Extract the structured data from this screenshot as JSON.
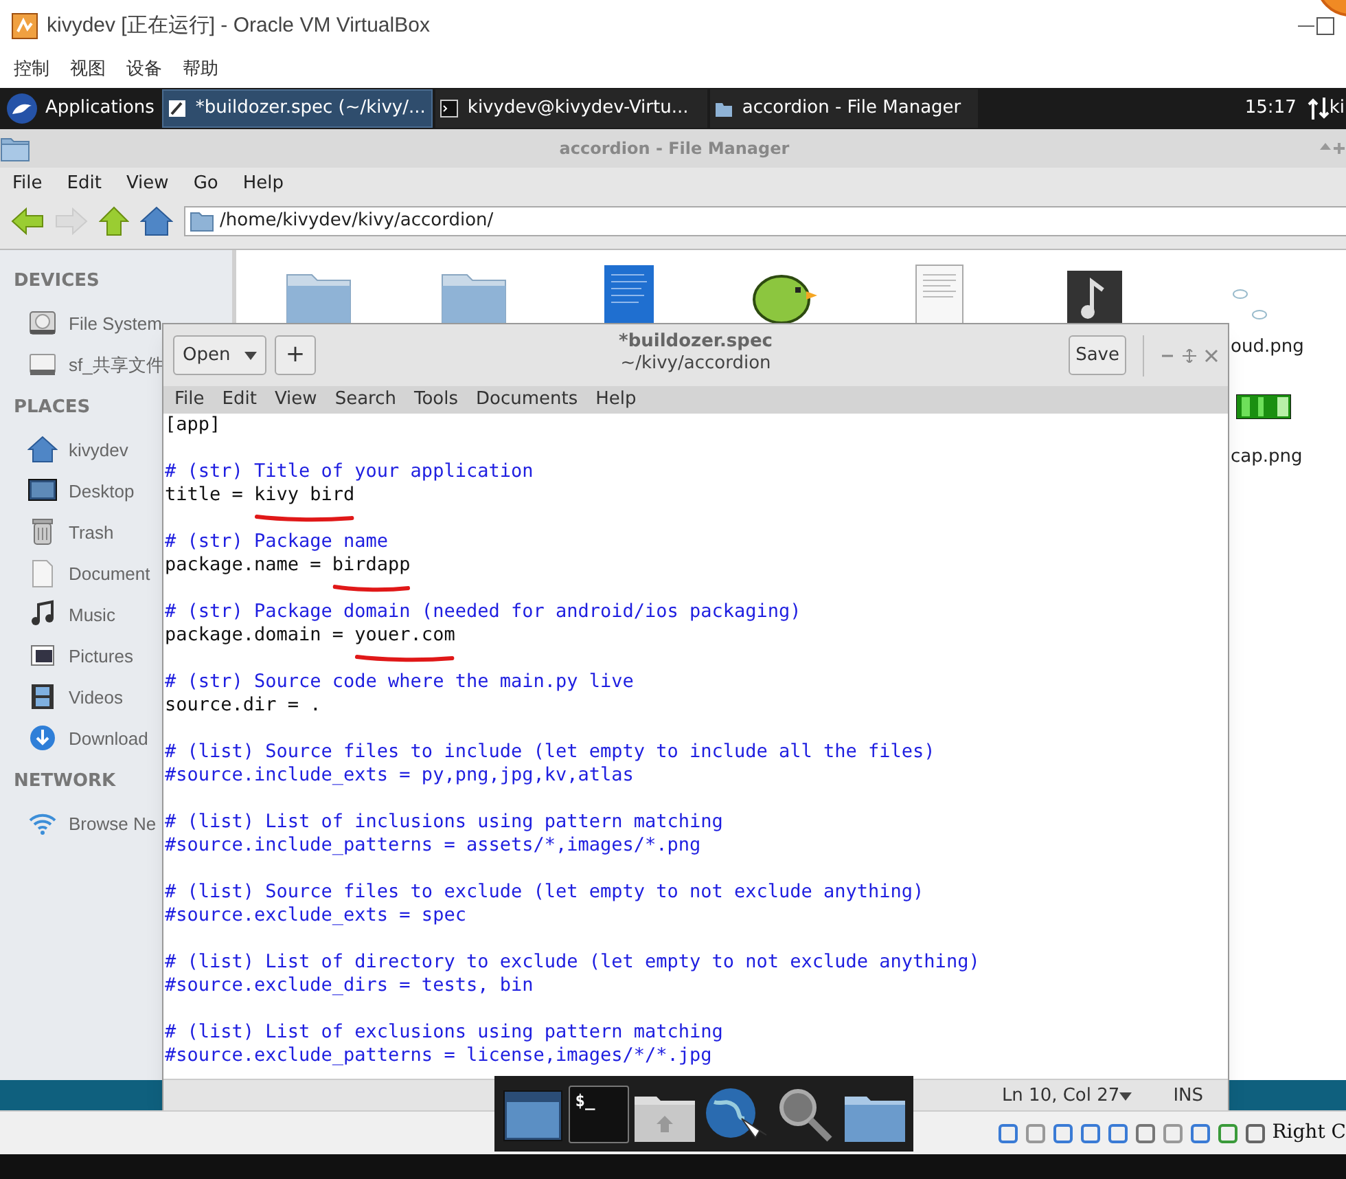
{
  "host_window": {
    "title": "kivydev [正在运行] - Oracle VM VirtualBox",
    "menu": [
      "控制",
      "视图",
      "设备",
      "帮助"
    ]
  },
  "taskbar": {
    "apps_label": "Applications",
    "tasks": [
      {
        "label": "*buildozer.spec (~/kivy/...",
        "kind": "editor",
        "selected": true
      },
      {
        "label": "kivydev@kivydev-Virtu...",
        "kind": "terminal",
        "selected": false
      },
      {
        "label": "accordion - File Manager",
        "kind": "folder",
        "selected": false
      }
    ],
    "clock": "15:17",
    "user": "ki"
  },
  "file_manager": {
    "title": "accordion - File Manager",
    "menu": [
      "File",
      "Edit",
      "View",
      "Go",
      "Help"
    ],
    "path": "/home/kivydev/kivy/accordion/",
    "sidebar": [
      {
        "heading": "DEVICES",
        "items": [
          {
            "label": "File System",
            "kind": "disk"
          },
          {
            "label": "sf_共享文件",
            "kind": "drive"
          }
        ]
      },
      {
        "heading": "PLACES",
        "items": [
          {
            "label": "kivydev",
            "kind": "home"
          },
          {
            "label": "Desktop",
            "kind": "desktop"
          },
          {
            "label": "Trash",
            "kind": "trash"
          },
          {
            "label": "Document",
            "kind": "document"
          },
          {
            "label": "Music",
            "kind": "music"
          },
          {
            "label": "Pictures",
            "kind": "pictures"
          },
          {
            "label": "Videos",
            "kind": "videos"
          },
          {
            "label": "Download",
            "kind": "download"
          }
        ]
      },
      {
        "heading": "NETWORK",
        "items": [
          {
            "label": "Browse Ne",
            "kind": "wifi"
          }
        ]
      }
    ],
    "files": [
      {
        "kind": "folder"
      },
      {
        "kind": "folder"
      },
      {
        "kind": "blue-doc"
      },
      {
        "kind": "bird"
      },
      {
        "kind": "text-doc"
      },
      {
        "kind": "music"
      },
      {
        "kind": "cloud"
      }
    ],
    "side_files": [
      {
        "kind": "cloud-label",
        "label": "oud.png"
      },
      {
        "kind": "bar",
        "label": "cap.png"
      }
    ]
  },
  "editor": {
    "title": "*buildozer.spec",
    "subtitle": "~/kivy/accordion",
    "open_label": "Open",
    "new_label": "+",
    "save_label": "Save",
    "menu": [
      "File",
      "Edit",
      "View",
      "Search",
      "Tools",
      "Documents",
      "Help"
    ],
    "lines": [
      {
        "kind": "code",
        "text": "[app]"
      },
      {
        "kind": "blank"
      },
      {
        "kind": "comment",
        "text": "# (str) Title of your application"
      },
      {
        "kind": "code",
        "text": "title = ",
        "marked": "kivy bird"
      },
      {
        "kind": "blank"
      },
      {
        "kind": "comment",
        "text": "# (str) Package name"
      },
      {
        "kind": "code",
        "text": "package.name = ",
        "marked": "birdapp"
      },
      {
        "kind": "blank"
      },
      {
        "kind": "comment",
        "text": "# (str) Package domain (needed for android/ios packaging)"
      },
      {
        "kind": "code",
        "text": "package.domain = ",
        "marked": "youer.com"
      },
      {
        "kind": "blank"
      },
      {
        "kind": "comment",
        "text": "# (str) Source code where the main.py live"
      },
      {
        "kind": "code",
        "text": "source.dir = ."
      },
      {
        "kind": "blank"
      },
      {
        "kind": "comment",
        "text": "# (list) Source files to include (let empty to include all the files)"
      },
      {
        "kind": "comment",
        "text": "#source.include_exts = py,png,jpg,kv,atlas"
      },
      {
        "kind": "blank"
      },
      {
        "kind": "comment",
        "text": "# (list) List of inclusions using pattern matching"
      },
      {
        "kind": "comment",
        "text": "#source.include_patterns = assets/*,images/*.png"
      },
      {
        "kind": "blank"
      },
      {
        "kind": "comment",
        "text": "# (list) Source files to exclude (let empty to not exclude anything)"
      },
      {
        "kind": "comment",
        "text": "#source.exclude_exts = spec"
      },
      {
        "kind": "blank"
      },
      {
        "kind": "comment",
        "text": "# (list) List of directory to exclude (let empty to not exclude anything)"
      },
      {
        "kind": "comment",
        "text": "#source.exclude_dirs = tests, bin"
      },
      {
        "kind": "blank"
      },
      {
        "kind": "comment",
        "text": "# (list) List of exclusions using pattern matching"
      },
      {
        "kind": "comment",
        "text": "#source.exclude_patterns = license,images/*/*.jpg"
      }
    ],
    "status": {
      "position": "Ln 10, Col 27",
      "mode": "INS"
    }
  },
  "dock": {
    "items": [
      {
        "kind": "screen"
      },
      {
        "kind": "terminal",
        "label": "$_"
      },
      {
        "kind": "home-folder"
      },
      {
        "kind": "globe"
      },
      {
        "kind": "magnifier"
      },
      {
        "kind": "folder"
      }
    ]
  },
  "host_status": {
    "text": "Right C"
  }
}
